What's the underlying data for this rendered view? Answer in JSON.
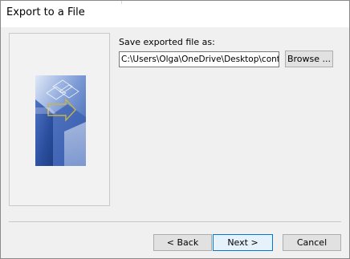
{
  "window": {
    "title": "Export to a File"
  },
  "form": {
    "label": "Save exported file as:",
    "path_value": "C:\\Users\\Olga\\OneDrive\\Desktop\\contacts",
    "browse_label": "Browse ..."
  },
  "footer": {
    "back_label": "< Back",
    "next_label": "Next >",
    "cancel_label": "Cancel"
  },
  "colors": {
    "dialog_bg": "#f0f0f0",
    "titlebar_bg": "#ffffff",
    "default_button_border": "#0078d7",
    "default_button_bg": "#e5f1fb",
    "art_blue_dark": "#2b4f9e",
    "art_blue_light": "#c9d8f0",
    "art_arrow": "#c8b34a"
  },
  "icons": {
    "wizard_art": "export-wizard-graphic"
  }
}
